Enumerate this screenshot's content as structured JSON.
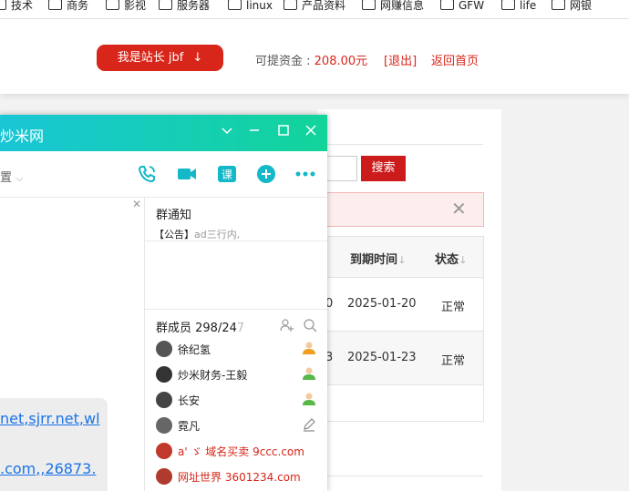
{
  "bookmarks": [
    {
      "label": "技术"
    },
    {
      "label": "商务"
    },
    {
      "label": "影视"
    },
    {
      "label": "服务器"
    },
    {
      "label": "linux"
    },
    {
      "label": "产品资料"
    },
    {
      "label": "网赚信息"
    },
    {
      "label": "GFW"
    },
    {
      "label": "life"
    },
    {
      "label": "网银"
    }
  ],
  "header": {
    "owner_button": "我是站长  jbf",
    "owner_arrow": "↓",
    "funds_label": "可提资金 : ",
    "funds_amount": "208.00元",
    "logout": "[退出]",
    "home": "返回首页"
  },
  "search": {
    "button": "搜索"
  },
  "table": {
    "headers": [
      "到期时间",
      "状态"
    ],
    "rows": [
      {
        "prefix": "0",
        "expiry": "2025-01-20",
        "status": "正常"
      },
      {
        "prefix": "3",
        "expiry": "2025-01-23",
        "status": "正常"
      }
    ]
  },
  "qq": {
    "title": "炒米网",
    "settings_label": "置",
    "chat_links": [
      [
        "net",
        "sjrr.net",
        "wl"
      ],
      [
        ".com",
        "",
        "26873."
      ]
    ],
    "notice": {
      "title": "群通知",
      "tag": "【公告】",
      "text": "ad三行内,"
    },
    "members": {
      "title": "群成员 298/24",
      "title_fade": "7",
      "list": [
        {
          "name": "徐纪氢",
          "color": "#555",
          "red": false,
          "role": "owner"
        },
        {
          "name": "炒米财务-王毅",
          "color": "#333",
          "red": false,
          "role": "admin"
        },
        {
          "name": "长安",
          "color": "#444",
          "red": false,
          "role": "admin"
        },
        {
          "name": "霓凡",
          "color": "#666",
          "red": false,
          "role": "edit"
        },
        {
          "name": "a' ゞ 域名买卖 9ccc.com",
          "color": "#c0392b",
          "red": true,
          "role": ""
        },
        {
          "name": "网址世界 3601234.com",
          "color": "#b03a2e",
          "red": true,
          "role": ""
        }
      ]
    }
  }
}
